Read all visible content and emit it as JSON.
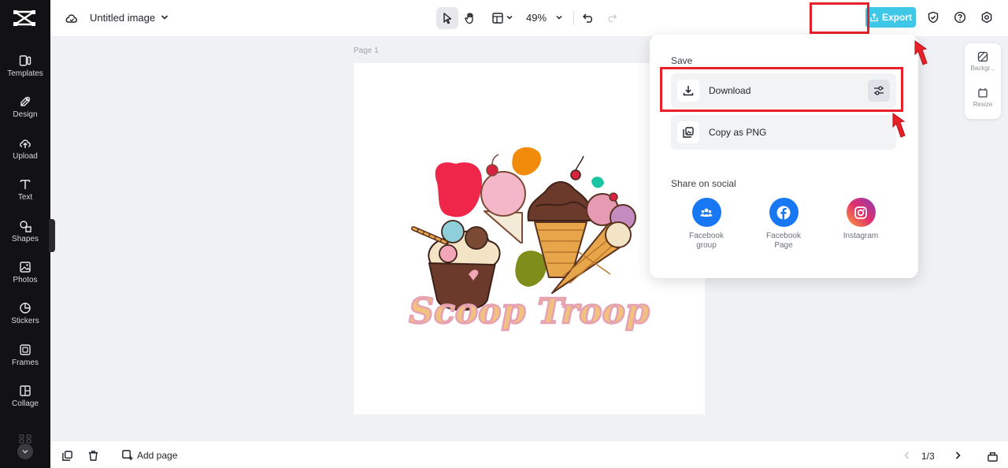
{
  "sidebar": {
    "items": [
      {
        "label": "Templates",
        "icon": "templates-icon"
      },
      {
        "label": "Design",
        "icon": "design-icon"
      },
      {
        "label": "Upload",
        "icon": "upload-icon"
      },
      {
        "label": "Text",
        "icon": "text-icon"
      },
      {
        "label": "Shapes",
        "icon": "shapes-icon"
      },
      {
        "label": "Photos",
        "icon": "photos-icon"
      },
      {
        "label": "Stickers",
        "icon": "stickers-icon"
      },
      {
        "label": "Frames",
        "icon": "frames-icon"
      },
      {
        "label": "Collage",
        "icon": "collage-icon"
      }
    ]
  },
  "header": {
    "title": "Untitled image",
    "zoom": "49%",
    "export_label": "Export"
  },
  "canvas": {
    "page_label": "Page 1",
    "logo_text": "Scoop Troop"
  },
  "right_panel": {
    "background_label": "Backgr...",
    "resize_label": "Resize"
  },
  "export_menu": {
    "save_heading": "Save",
    "download_label": "Download",
    "copy_label": "Copy as PNG",
    "share_heading": "Share on social",
    "social": [
      {
        "label": "Facebook group",
        "color": "#1877f2"
      },
      {
        "label": "Facebook Page",
        "color": "#1877f2"
      },
      {
        "label": "Instagram",
        "color": "#e1306c"
      }
    ]
  },
  "footer": {
    "add_page_label": "Add page",
    "page_count": "1/3"
  },
  "colors": {
    "sidebar_bg": "#121214",
    "accent_export": "#3ec7e6",
    "highlight_red": "#e8202a"
  }
}
